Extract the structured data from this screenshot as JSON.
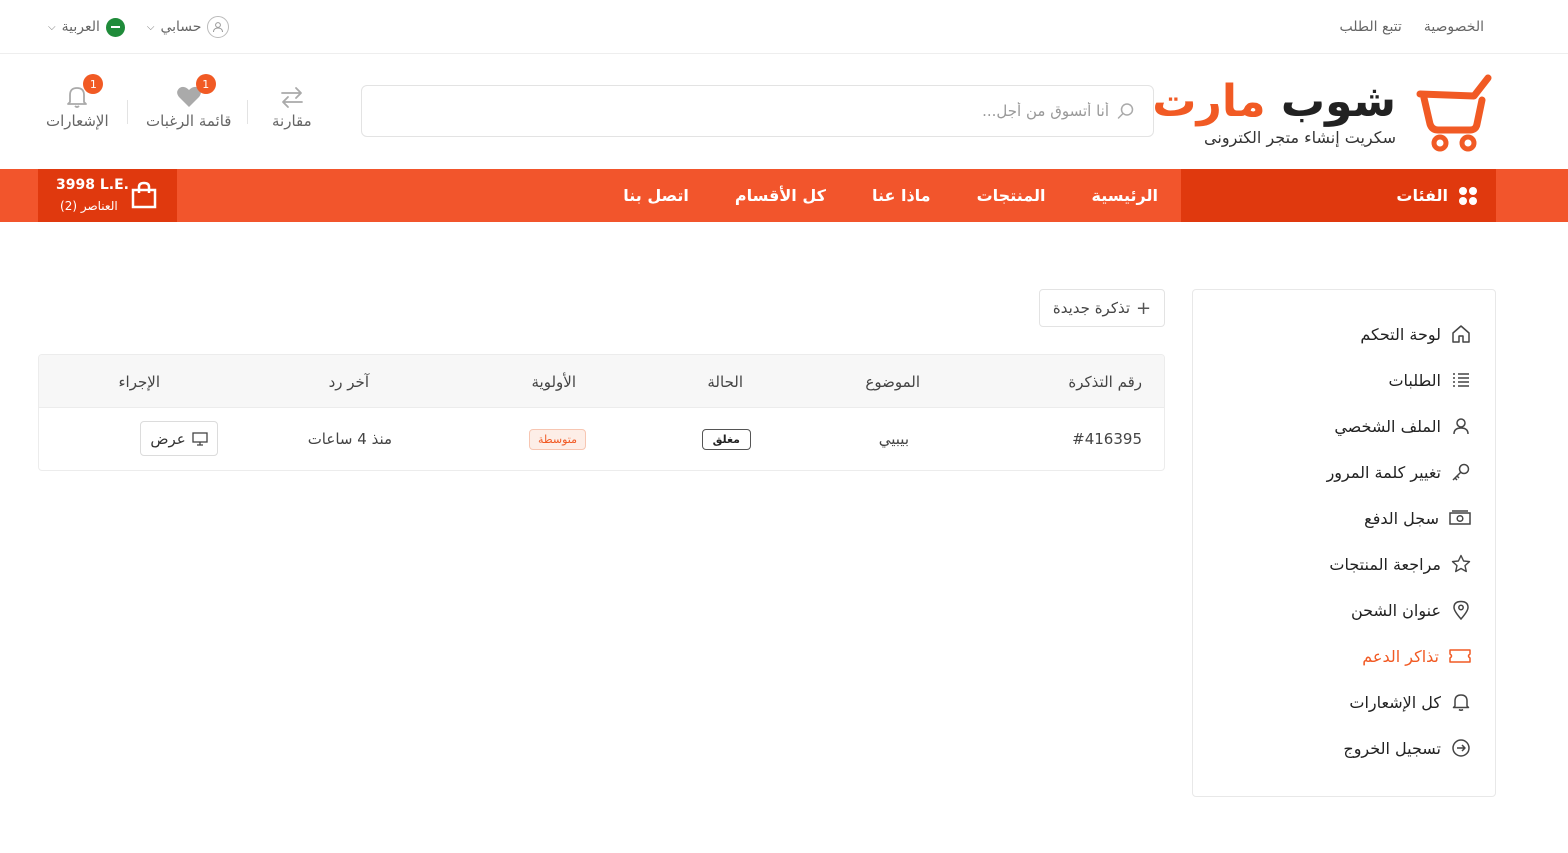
{
  "topbar": {
    "privacy": "الخصوصية",
    "track_order": "تتبع الطلب",
    "language": "العربية",
    "account": "حسابي"
  },
  "header": {
    "brand_part1": "شوب",
    "brand_part2": "مارت",
    "tagline": "سكريت إنشاء متجر الكترونى",
    "search_placeholder": "أنا أتسوق من أجل...",
    "compare_label": "مقارنة",
    "wishlist_label": "قائمة الرغبات",
    "wishlist_count": "1",
    "notifications_label": "الإشعارات",
    "notifications_count": "1"
  },
  "nav": {
    "categories": "الفئات",
    "links": [
      "الرئيسية",
      "المنتجات",
      "ماذا عنا",
      "كل الأقسام",
      "اتصل بنا"
    ],
    "cart_total": "3998 L.E.",
    "cart_items": "العناصر (2)"
  },
  "sidebar": {
    "items": [
      {
        "label": "لوحة التحكم",
        "icon": "home-icon"
      },
      {
        "label": "الطلبات",
        "icon": "list-icon"
      },
      {
        "label": "الملف الشخصي",
        "icon": "user-icon"
      },
      {
        "label": "تغيير كلمة المرور",
        "icon": "key-icon"
      },
      {
        "label": "سجل الدفع",
        "icon": "money-icon"
      },
      {
        "label": "مراجعة المنتجات",
        "icon": "star-icon"
      },
      {
        "label": "عنوان الشحن",
        "icon": "location-icon"
      },
      {
        "label": "تذاكر الدعم",
        "icon": "ticket-icon",
        "active": true
      },
      {
        "label": "كل الإشعارات",
        "icon": "bell-icon"
      },
      {
        "label": "تسجيل الخروج",
        "icon": "logout-icon"
      }
    ]
  },
  "main": {
    "new_ticket": "تذكرة جديدة",
    "columns": [
      "رقم التذكرة",
      "الموضوع",
      "الحالة",
      "الأولوية",
      "آخر رد",
      "الإجراء"
    ],
    "rows": [
      {
        "id": "#416395",
        "subject": "بيبيي",
        "status": "مغلق",
        "priority": "متوسطة",
        "last_reply": "منذ 4 ساعات",
        "action": "عرض"
      }
    ]
  },
  "colors": {
    "accent": "#f15a24",
    "accent_dark": "#e0390e",
    "nav_bg": "#f2552c"
  }
}
